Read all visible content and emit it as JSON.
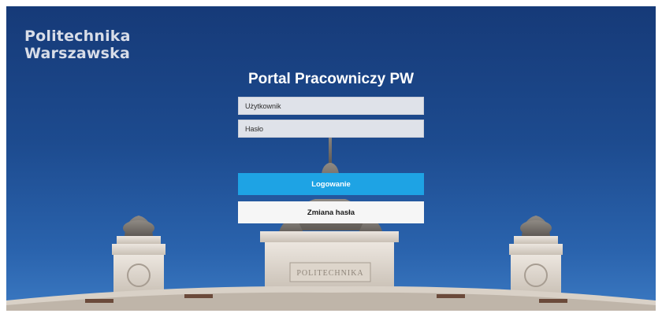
{
  "logo": {
    "line1": "Politechnika",
    "line2": "Warszawska"
  },
  "page_title": "Portal Pracowniczy PW",
  "form": {
    "username_placeholder": "Użytkownik",
    "password_placeholder": "Hasło",
    "login_label": "Logowanie",
    "change_password_label": "Zmiana hasła"
  },
  "building": {
    "inscription": "POLITECHNIKA"
  },
  "colors": {
    "sky_top": "#163a78",
    "sky_bottom": "#3b79c2",
    "login_button": "#1ea3e4",
    "field_background": "#dfe2e9"
  }
}
